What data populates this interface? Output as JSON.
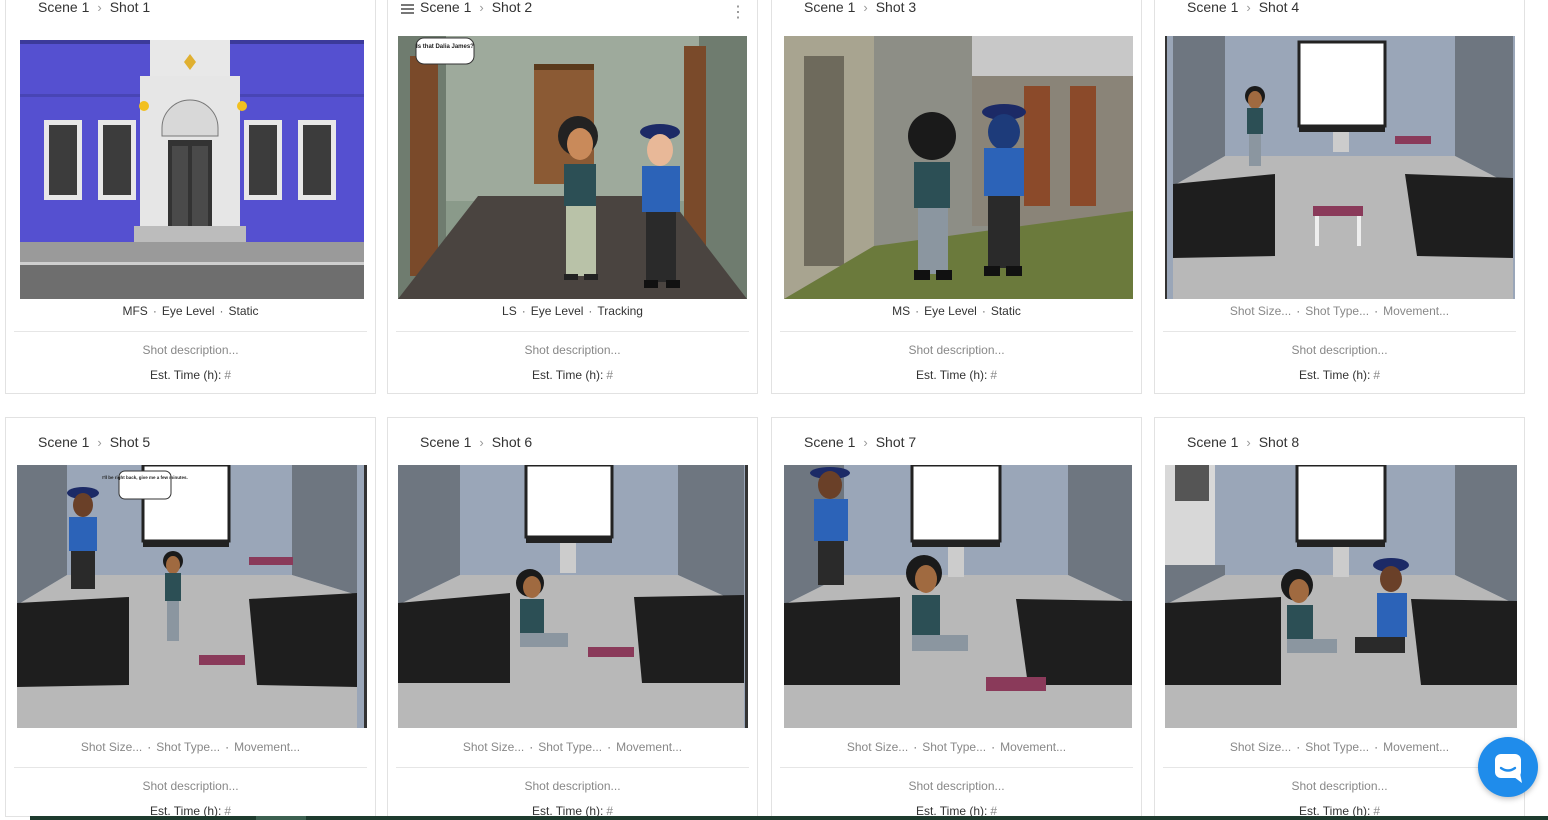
{
  "shots": [
    {
      "scene": "Scene 1",
      "shot": "Shot 1",
      "size": "MFS",
      "type": "Eye Level",
      "movement": "Static",
      "description_placeholder": "Shot description...",
      "est_label": "Est. Time (h):",
      "est_value": "#"
    },
    {
      "scene": "Scene 1",
      "shot": "Shot 2",
      "size": "LS",
      "type": "Eye Level",
      "movement": "Tracking",
      "description_placeholder": "Shot description...",
      "est_label": "Est. Time (h):",
      "est_value": "#",
      "bubble": "Is that Dalia James?"
    },
    {
      "scene": "Scene 1",
      "shot": "Shot 3",
      "size": "MS",
      "type": "Eye Level",
      "movement": "Static",
      "description_placeholder": "Shot description...",
      "est_label": "Est. Time (h):",
      "est_value": "#"
    },
    {
      "scene": "Scene 1",
      "shot": "Shot 4",
      "size": "Shot Size...",
      "type": "Shot Type...",
      "movement": "Movement...",
      "description_placeholder": "Shot description...",
      "est_label": "Est. Time (h):",
      "est_value": "#"
    },
    {
      "scene": "Scene 1",
      "shot": "Shot 5",
      "size": "Shot Size...",
      "type": "Shot Type...",
      "movement": "Movement...",
      "description_placeholder": "Shot description...",
      "est_label": "Est. Time (h):",
      "est_value": "#",
      "bubble": "I'll be right back, give me a few minutes."
    },
    {
      "scene": "Scene 1",
      "shot": "Shot 6",
      "size": "Shot Size...",
      "type": "Shot Type...",
      "movement": "Movement...",
      "description_placeholder": "Shot description...",
      "est_label": "Est. Time (h):",
      "est_value": "#"
    },
    {
      "scene": "Scene 1",
      "shot": "Shot 7",
      "size": "Shot Size...",
      "type": "Shot Type...",
      "movement": "Movement...",
      "description_placeholder": "Shot description...",
      "est_label": "Est. Time (h):",
      "est_value": "#"
    },
    {
      "scene": "Scene 1",
      "shot": "Shot 8",
      "size": "Shot Size...",
      "type": "Shot Type...",
      "movement": "Movement...",
      "description_placeholder": "Shot description...",
      "est_label": "Est. Time (h):",
      "est_value": "#"
    }
  ],
  "colors": {
    "accent": "#1f8ceb",
    "police_blue": "#2c63b8",
    "building_purple": "#5b56d0",
    "wall_grey": "#97a4b5"
  },
  "icons": {
    "breadcrumb": "chevron-right-icon",
    "drag": "drag-handle-icon",
    "menu": "kebab-menu-icon",
    "chat": "chat-icon"
  }
}
